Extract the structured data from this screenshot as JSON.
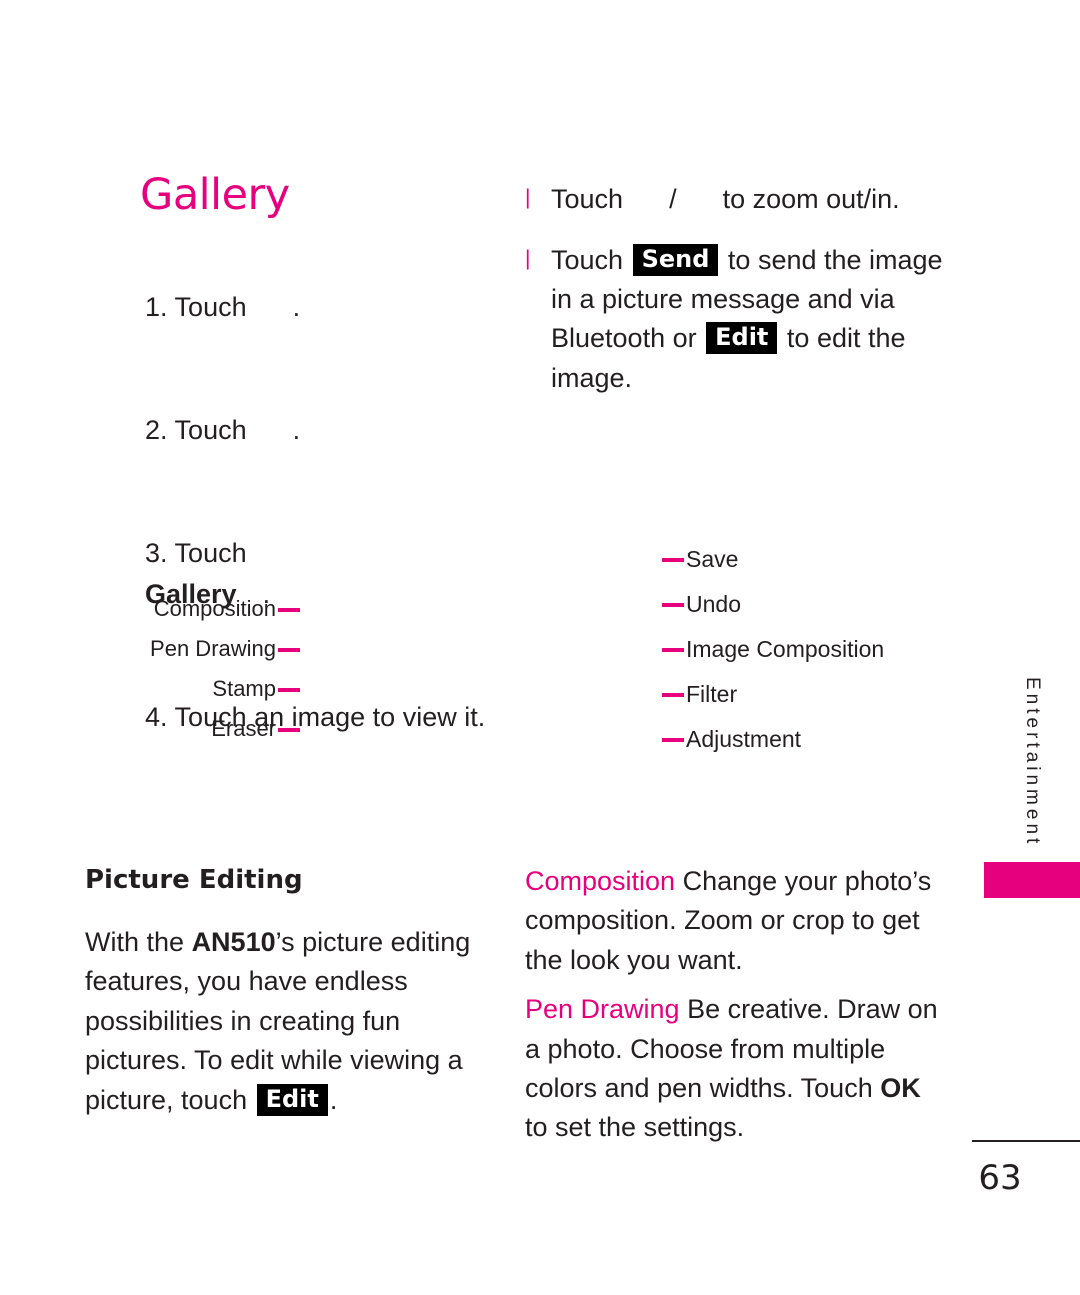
{
  "page": {
    "number": "63",
    "side_tab": "Entertainment",
    "accent_color": "#e6007e"
  },
  "left_column": {
    "title": "Gallery",
    "steps": [
      {
        "prefix": "1. Touch",
        "suffix": ".",
        "bold": ""
      },
      {
        "prefix": "2. Touch",
        "suffix": ".",
        "bold": ""
      },
      {
        "prefix": "3. Touch",
        "bold": "Gallery",
        "suffix": "."
      },
      {
        "prefix": "4. Touch an image to view it.",
        "bold": "",
        "suffix": ""
      }
    ]
  },
  "right_column": {
    "bullets": [
      {
        "part1": "Touch",
        "part2": "/",
        "part3": "to zoom out/in."
      }
    ],
    "send_bullet": {
      "lead": "Touch",
      "key_send": "Send",
      "mid": "to send the image in a picture message and via Bluetooth or",
      "key_edit": "Edit",
      "tail": "to edit the image."
    }
  },
  "callouts": {
    "left": [
      "Composition",
      "Pen Drawing",
      "Stamp",
      "Eraser"
    ],
    "right": [
      "Save",
      "Undo",
      "Image Composition",
      "Filter",
      "Adjustment"
    ]
  },
  "picture_editing": {
    "heading": "Picture Editing",
    "body_pre": "With the",
    "body_model": "AN510",
    "body_mid": "’s picture editing features, you have endless possibilities in creating fun pictures. To edit while viewing a picture, touch",
    "key_edit": "Edit",
    "body_end": "."
  },
  "features": [
    {
      "term": "Composition",
      "text": "Change your photo’s composition. Zoom or crop to get the look you want."
    },
    {
      "term": "Pen Drawing",
      "text_pre": "Be creative. Draw on a photo. Choose from multiple colors and pen widths. Touch",
      "bold_key": "OK",
      "text_post": "to set the settings."
    }
  ]
}
